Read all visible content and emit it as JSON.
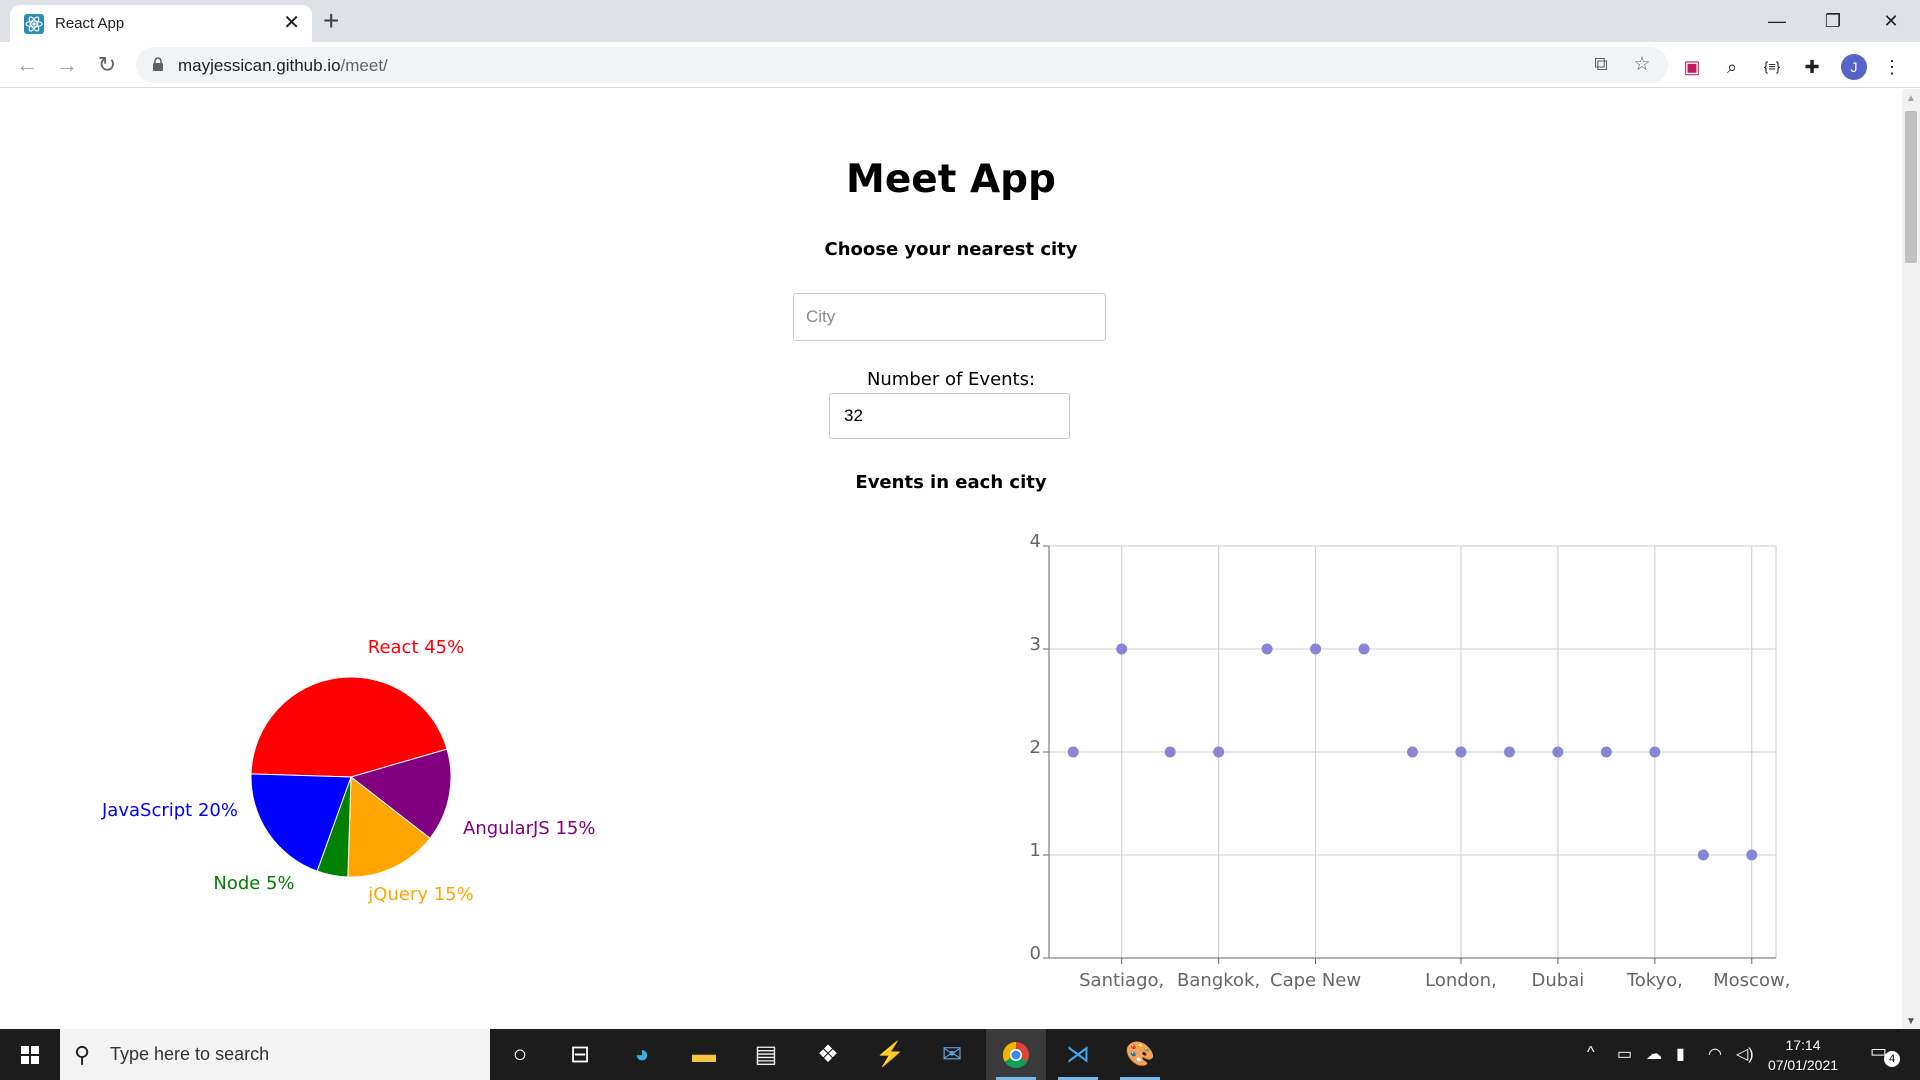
{
  "browser": {
    "tab_title": "React App",
    "url_host": "mayjessican.github.io",
    "url_path": "/meet/",
    "avatar_letter": "J"
  },
  "page": {
    "title": "Meet App",
    "city_label": "Choose your nearest city",
    "city_placeholder": "City",
    "events_label": "Number of Events:",
    "events_value": "32",
    "chart_heading": "Events in each city"
  },
  "chart_data": [
    {
      "type": "pie",
      "slices": [
        {
          "label": "React 45%",
          "value": 45,
          "color": "#ff0000"
        },
        {
          "label": "AngularJS 15%",
          "value": 15,
          "color": "#800080"
        },
        {
          "label": "jQuery 15%",
          "value": 15,
          "color": "#ffa500"
        },
        {
          "label": "Node 5%",
          "value": 5,
          "color": "#008000"
        },
        {
          "label": "JavaScript 20%",
          "value": 20,
          "color": "#0000ff"
        }
      ]
    },
    {
      "type": "scatter",
      "point_color": "#8884d8",
      "ylim": [
        0,
        4
      ],
      "yticks": [
        0,
        1,
        2,
        3,
        4
      ],
      "x_tick_labels": [
        "Santiago,",
        "Bangkok,",
        "Cape New",
        "London,",
        "Dubai",
        "Tokyo,",
        "Moscow,"
      ],
      "x_tick_index": [
        1,
        3,
        5,
        8,
        10,
        12,
        14
      ],
      "values": [
        2,
        3,
        2,
        2,
        3,
        3,
        3,
        2,
        2,
        2,
        2,
        2,
        2,
        1,
        1
      ]
    }
  ],
  "taskbar": {
    "search_placeholder": "Type here to search",
    "time": "17:14",
    "date": "07/01/2021",
    "notification_count": "4"
  }
}
